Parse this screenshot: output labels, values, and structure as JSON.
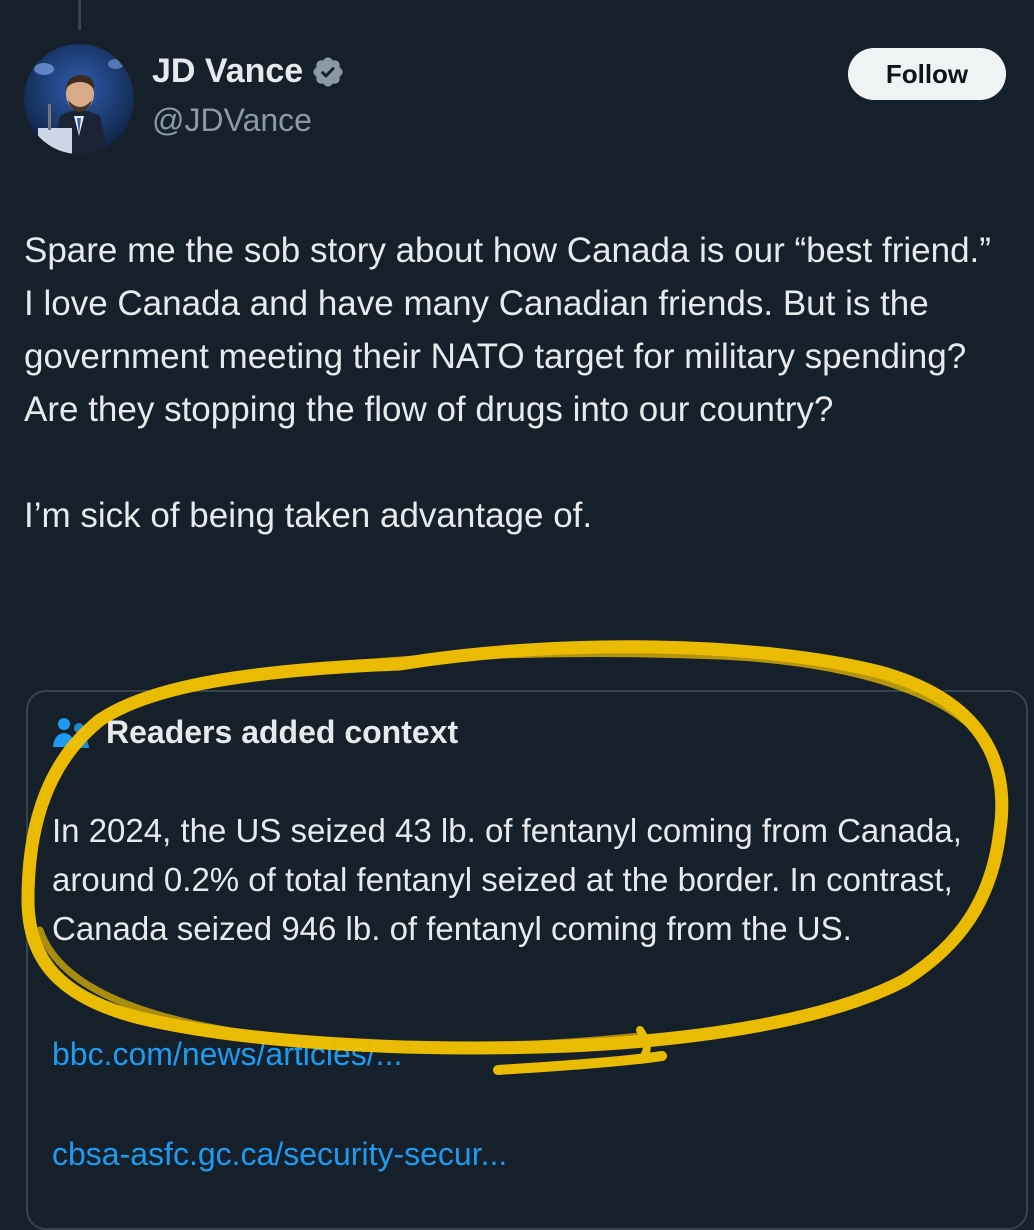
{
  "tweet": {
    "author": {
      "display_name": "JD Vance",
      "handle": "@JDVance",
      "verified": true
    },
    "follow_label": "Follow",
    "paragraphs": [
      "Spare me the sob story about how Canada is our “best friend.” I love Canada and have many Canadian friends. But is the government meeting their NATO target for military spending? Are they stopping the flow of drugs into our country?",
      "I’m sick of being taken advantage of."
    ]
  },
  "community_note": {
    "title": "Readers added context",
    "text": "In 2024, the US seized 43 lb. of fentanyl coming from Canada, around 0.2% of total fentanyl seized at the border. In contrast, Canada seized 946 lb. of fentanyl coming from the US.",
    "links": [
      "bbc.com/news/articles/...",
      "cbsa-asfc.gc.ca/security-secur..."
    ]
  },
  "colors": {
    "background": "#15202b",
    "text": "#e7e9ea",
    "secondary_text": "#8b98a5",
    "link": "#1d9bf0",
    "verified_badge": "#8b98a5",
    "note_icon": "#1d9bf0",
    "highlighter": "#f5c400"
  }
}
